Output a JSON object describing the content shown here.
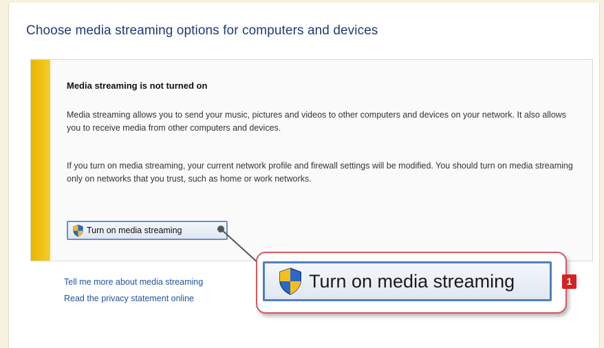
{
  "heading": "Choose media streaming options for computers and devices",
  "notice": {
    "title": "Media streaming is not turned on",
    "paragraph1": "Media streaming allows you to send your music, pictures and videos to other computers and devices on your network.  It also allows you to receive media from other computers and devices.",
    "paragraph2": "If you turn on media streaming, your current network profile and firewall settings will be modified. You should turn on media streaming only on networks that you trust, such as home or work networks.",
    "button_label": "Turn on media streaming",
    "button_icon": "uac-shield-icon"
  },
  "links": {
    "tell_more": "Tell me more about media streaming",
    "privacy": "Read the privacy statement online"
  },
  "callout": {
    "button_label": "Turn on media streaming",
    "step_number": "1"
  },
  "colors": {
    "heading": "#1e3a78",
    "accent_bar": "#f0c419",
    "link": "#2352a0",
    "callout_border": "#d4595f",
    "badge": "#d42322",
    "button_border": "#4f7ec0"
  }
}
